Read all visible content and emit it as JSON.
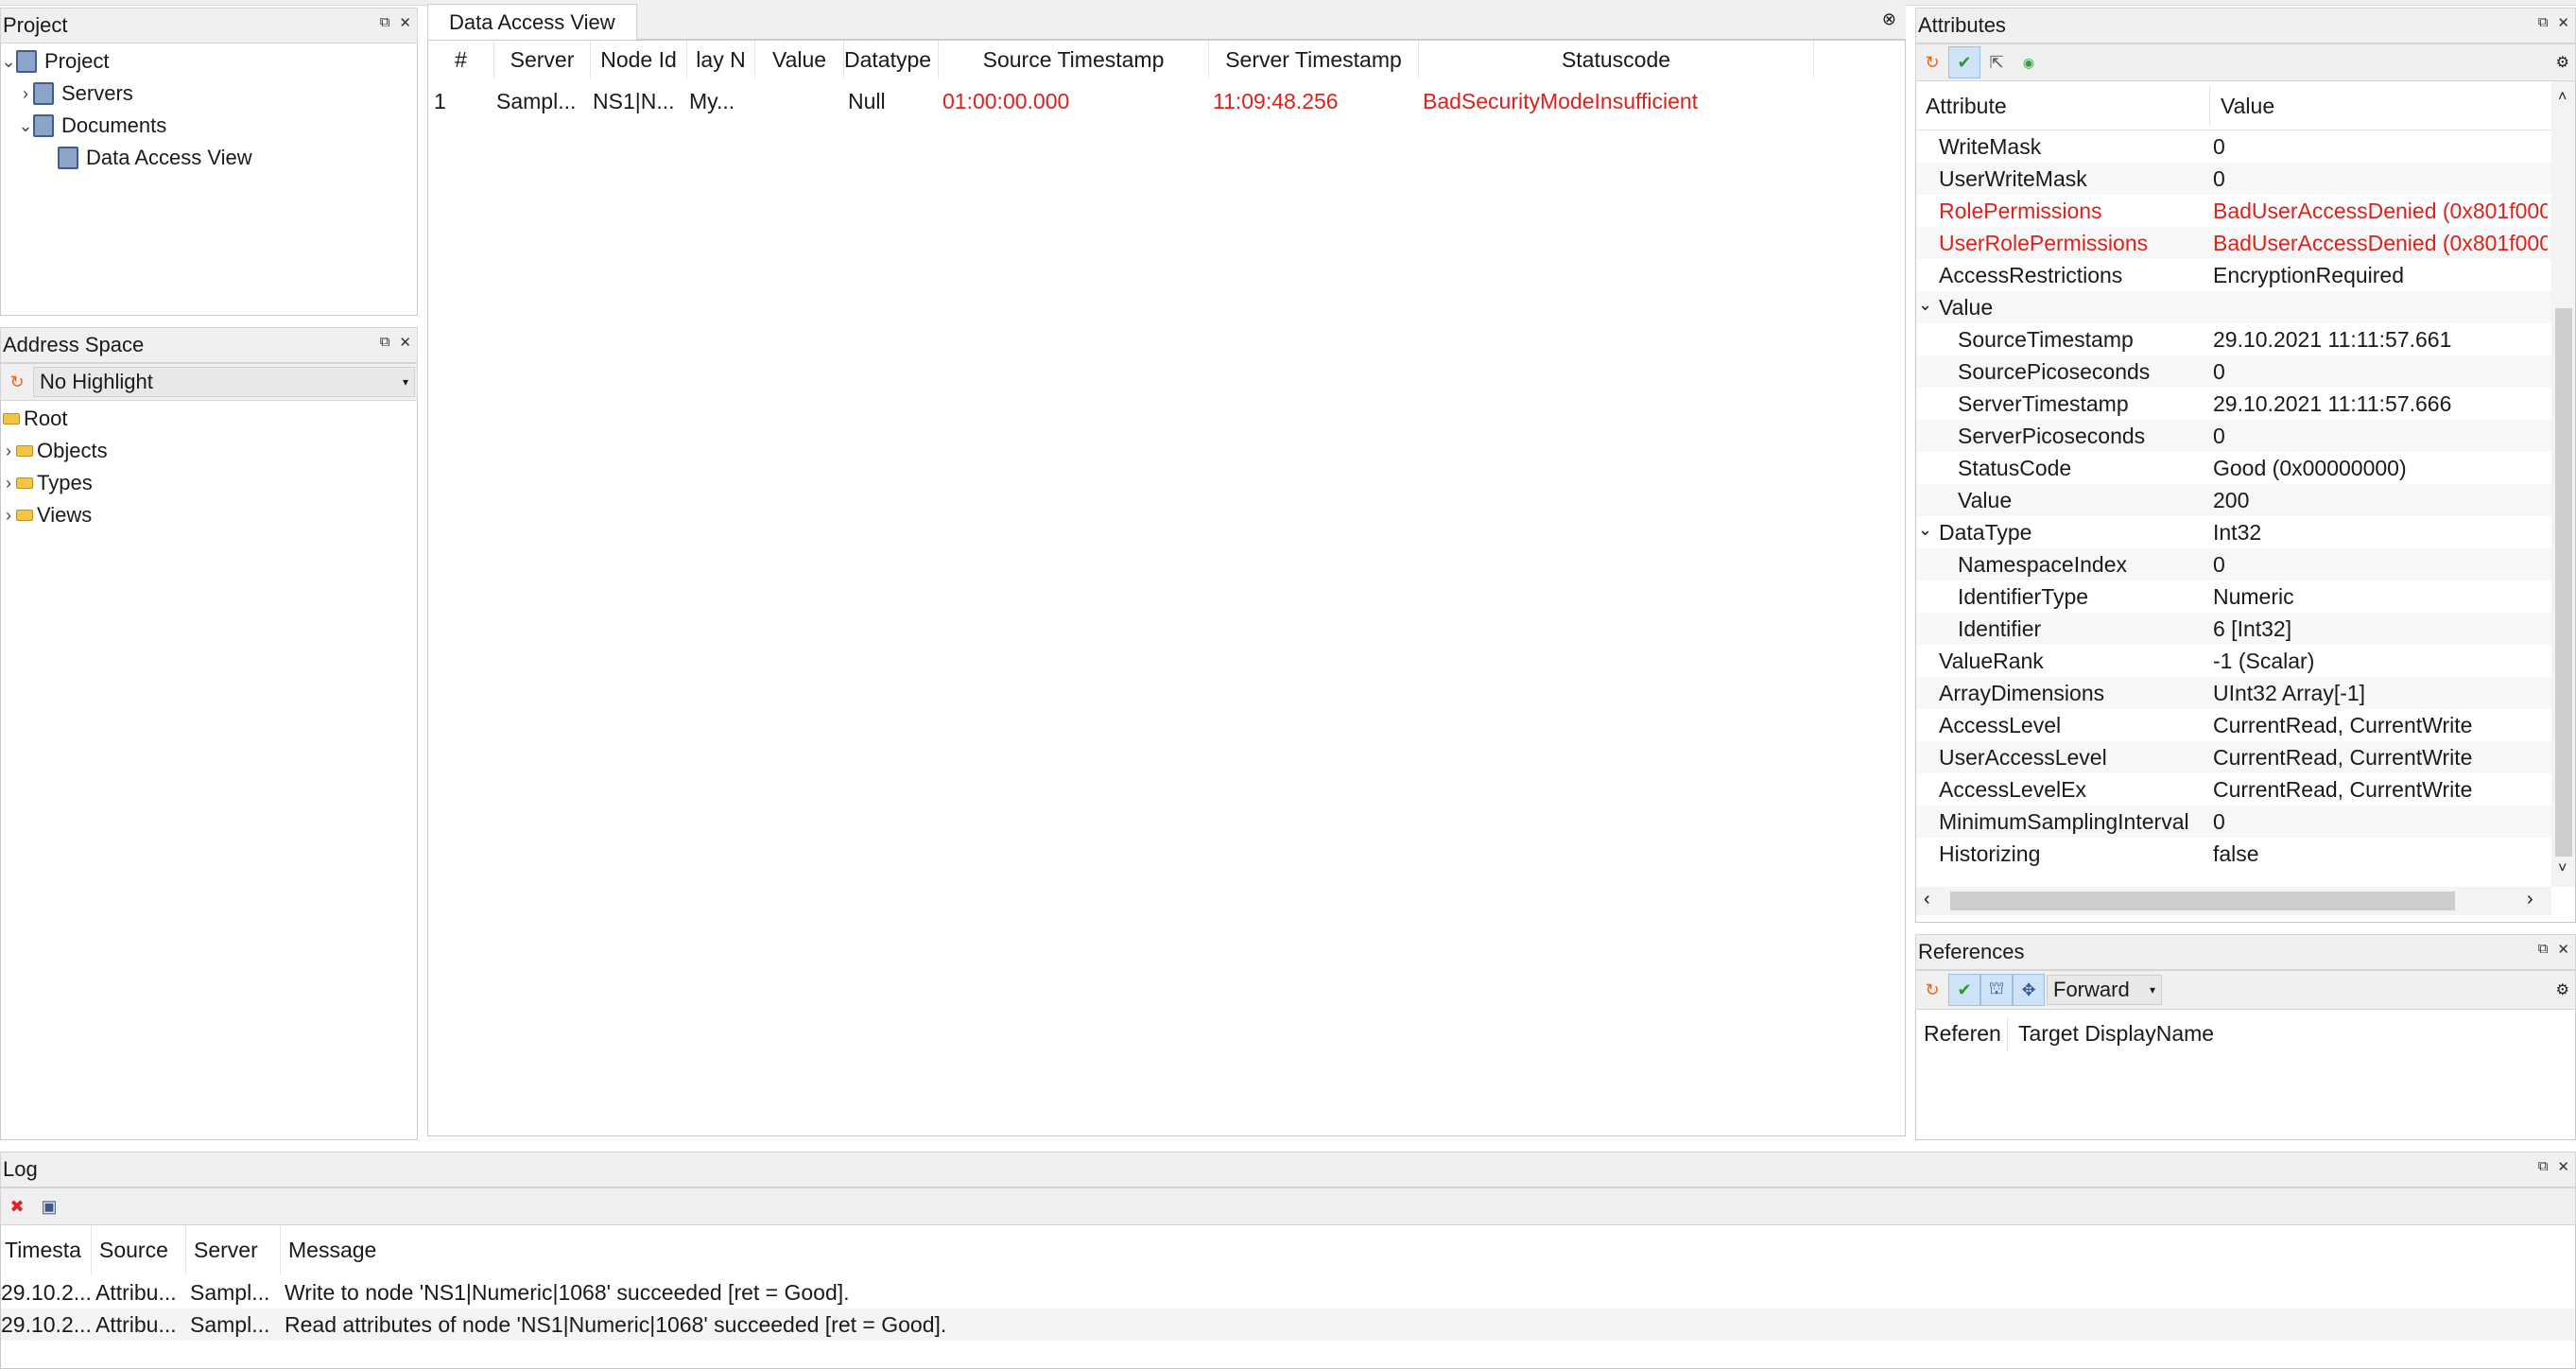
{
  "project_panel": {
    "title": "Project",
    "tree": [
      {
        "label": "Project",
        "level": 0,
        "expanded": true,
        "icon": "book-icon"
      },
      {
        "label": "Servers",
        "level": 1,
        "expanded": false,
        "icon": "book-icon"
      },
      {
        "label": "Documents",
        "level": 1,
        "expanded": true,
        "icon": "book-icon"
      },
      {
        "label": "Data Access View",
        "level": 2,
        "expanded": null,
        "icon": "book-icon"
      }
    ]
  },
  "address_space": {
    "title": "Address Space",
    "highlight_select": "No Highlight",
    "tree": [
      {
        "label": "Root",
        "level": 0
      },
      {
        "label": "Objects",
        "level": 1
      },
      {
        "label": "Types",
        "level": 1
      },
      {
        "label": "Views",
        "level": 1
      }
    ]
  },
  "data_access": {
    "tab_label": "Data Access View",
    "columns": [
      "#",
      "Server",
      "Node Id",
      "lay N",
      "Value",
      "Datatype",
      "Source Timestamp",
      "Server Timestamp",
      "Statuscode"
    ],
    "rows": [
      {
        "num": "1",
        "server": "Sampl...",
        "node_id": "NS1|N...",
        "display_name": "My...",
        "value": "",
        "datatype": "Null",
        "source_ts": "01:00:00.000",
        "server_ts": "11:09:48.256",
        "status": "BadSecurityModeInsufficient"
      }
    ]
  },
  "attributes": {
    "title": "Attributes",
    "col_attribute": "Attribute",
    "col_value": "Value",
    "rows": [
      {
        "name": "WriteMask",
        "value": "0",
        "indent": 0,
        "red": false
      },
      {
        "name": "UserWriteMask",
        "value": "0",
        "indent": 0,
        "red": false
      },
      {
        "name": "RolePermissions",
        "value": "BadUserAccessDenied (0x801f000",
        "indent": 0,
        "red": true
      },
      {
        "name": "UserRolePermissions",
        "value": "BadUserAccessDenied (0x801f000",
        "indent": 0,
        "red": true
      },
      {
        "name": "AccessRestrictions",
        "value": "EncryptionRequired",
        "indent": 0,
        "red": false
      },
      {
        "name": "Value",
        "value": "",
        "indent": 0,
        "red": false,
        "expandable": true
      },
      {
        "name": "SourceTimestamp",
        "value": "29.10.2021 11:11:57.661",
        "indent": 1,
        "red": false
      },
      {
        "name": "SourcePicoseconds",
        "value": "0",
        "indent": 1,
        "red": false
      },
      {
        "name": "ServerTimestamp",
        "value": "29.10.2021 11:11:57.666",
        "indent": 1,
        "red": false
      },
      {
        "name": "ServerPicoseconds",
        "value": "0",
        "indent": 1,
        "red": false
      },
      {
        "name": "StatusCode",
        "value": "Good (0x00000000)",
        "indent": 1,
        "red": false
      },
      {
        "name": "Value",
        "value": "200",
        "indent": 1,
        "red": false
      },
      {
        "name": "DataType",
        "value": "Int32",
        "indent": 0,
        "red": false,
        "expandable": true
      },
      {
        "name": "NamespaceIndex",
        "value": "0",
        "indent": 1,
        "red": false
      },
      {
        "name": "IdentifierType",
        "value": "Numeric",
        "indent": 1,
        "red": false
      },
      {
        "name": "Identifier",
        "value": "6 [Int32]",
        "indent": 1,
        "red": false
      },
      {
        "name": "ValueRank",
        "value": "-1 (Scalar)",
        "indent": 0,
        "red": false
      },
      {
        "name": "ArrayDimensions",
        "value": "UInt32 Array[-1]",
        "indent": 0,
        "red": false
      },
      {
        "name": "AccessLevel",
        "value": "CurrentRead, CurrentWrite",
        "indent": 0,
        "red": false
      },
      {
        "name": "UserAccessLevel",
        "value": "CurrentRead, CurrentWrite",
        "indent": 0,
        "red": false
      },
      {
        "name": "AccessLevelEx",
        "value": "CurrentRead, CurrentWrite",
        "indent": 0,
        "red": false
      },
      {
        "name": "MinimumSamplingInterval",
        "value": "0",
        "indent": 0,
        "red": false
      },
      {
        "name": "Historizing",
        "value": "false",
        "indent": 0,
        "red": false
      }
    ]
  },
  "references": {
    "title": "References",
    "direction_select": "Forward",
    "col_reference": "Referen",
    "col_target": "Target DisplayName"
  },
  "log": {
    "title": "Log",
    "columns": [
      "Timesta",
      "Source",
      "Server",
      "Message"
    ],
    "rows": [
      {
        "time": "29.10.2...",
        "source": "Attribu...",
        "server": "Sampl...",
        "message": "Write to node 'NS1|Numeric|1068' succeeded [ret = Good]."
      },
      {
        "time": "29.10.2...",
        "source": "Attribu...",
        "server": "Sampl...",
        "message": "Read attributes of node 'NS1|Numeric|1068' succeeded [ret = Good]."
      }
    ]
  },
  "colors": {
    "error_red": "#e0201b",
    "panel_bg": "#f0f0f0",
    "selected_tool": "#cfe3f7"
  },
  "icons": {
    "refresh": "refresh-icon",
    "check": "check-icon",
    "cursor": "pointer-icon",
    "green_dot": "monitor-icon",
    "close": "close-icon",
    "float": "float-icon",
    "settings": "settings-icon",
    "hierarchy": "hierarchy-icon",
    "move": "move-icon",
    "clear_log": "clear-log-icon",
    "save_log": "save-log-icon"
  }
}
